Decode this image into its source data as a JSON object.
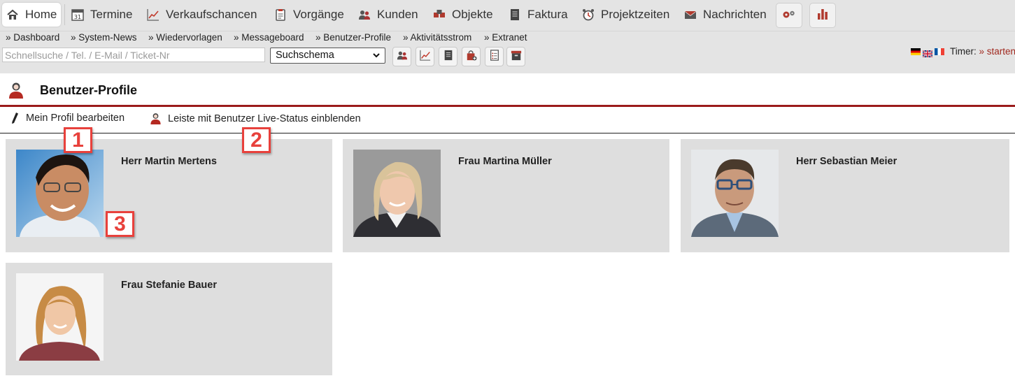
{
  "topnav": {
    "items": [
      {
        "label": "Home",
        "icon": "home-icon"
      },
      {
        "label": "Termine",
        "icon": "calendar-icon"
      },
      {
        "label": "Verkaufschancen",
        "icon": "chart-line-icon"
      },
      {
        "label": "Vorgänge",
        "icon": "clipboard-icon"
      },
      {
        "label": "Kunden",
        "icon": "users-icon"
      },
      {
        "label": "Objekte",
        "icon": "cubes-icon"
      },
      {
        "label": "Faktura",
        "icon": "invoice-icon"
      },
      {
        "label": "Projektzeiten",
        "icon": "alarm-clock-icon"
      },
      {
        "label": "Nachrichten",
        "icon": "envelope-icon"
      }
    ],
    "extra_buttons": [
      "gears-icon",
      "bar-chart-icon"
    ]
  },
  "subnav": {
    "links": [
      "» Dashboard",
      "» System-News",
      "» Wiedervorlagen",
      "» Messageboard",
      "» Benutzer-Profile",
      "» Aktivitätsstrom",
      "» Extranet"
    ]
  },
  "toolbar": {
    "search_placeholder": "Schnellsuche / Tel. / E-Mail / Ticket-Nr",
    "search_value": "",
    "schema_selected": "Suchschema",
    "quick_buttons": [
      "users-icon",
      "chart-line-icon",
      "invoice-icon",
      "bag-add-icon",
      "document-list-icon",
      "archive-box-icon"
    ],
    "languages": [
      "de-flag-icon",
      "uk-flag-icon",
      "fr-flag-icon"
    ],
    "timer_label": "Timer:",
    "timer_link": "» starten"
  },
  "page": {
    "title": "Benutzer-Profile",
    "title_icon": "user-profile-icon"
  },
  "actions": [
    {
      "label": "Mein Profil bearbeiten",
      "icon": "pencil-icon"
    },
    {
      "label": "Leiste mit Benutzer Live-Status einblenden",
      "icon": "user-status-icon"
    }
  ],
  "profiles": [
    {
      "name": "Herr Martin Mertens"
    },
    {
      "name": "Frau Martina Müller"
    },
    {
      "name": "Herr Sebastian Meier"
    },
    {
      "name": "Frau Stefanie Bauer"
    }
  ],
  "markers": [
    "1",
    "2",
    "3"
  ],
  "colors": {
    "accent_red": "#9b1b1b",
    "marker_red": "#e8413c",
    "nav_bg": "#e4e4e4",
    "card_bg": "#dedede",
    "link_red": "#a0281e"
  }
}
